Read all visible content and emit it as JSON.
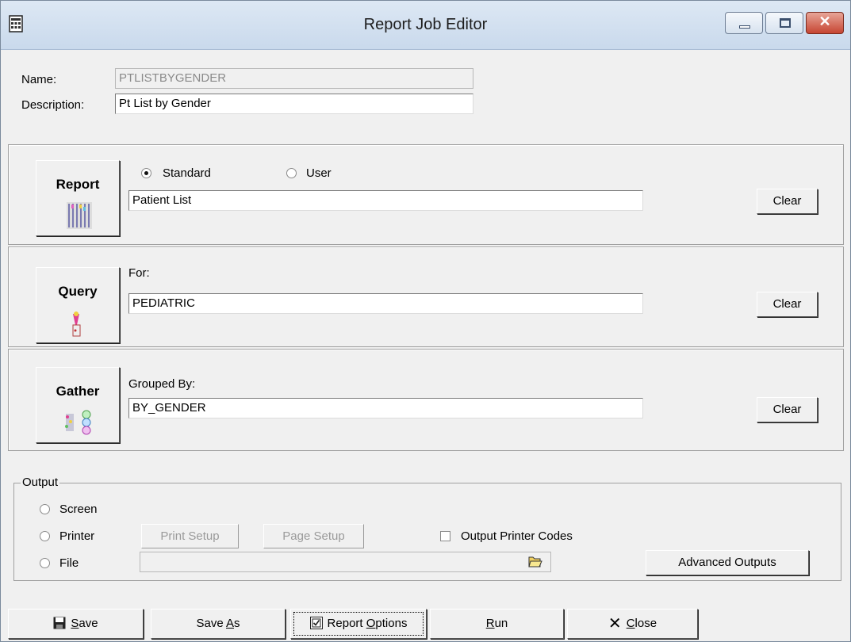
{
  "window": {
    "title": "Report Job Editor"
  },
  "header": {
    "name_label": "Name:",
    "name_value": "PTLISTBYGENDER",
    "description_label": "Description:",
    "description_value": "Pt List by Gender"
  },
  "report_panel": {
    "button_label": "Report",
    "radio_standard": "Standard",
    "radio_user": "User",
    "selected": "Standard",
    "value": "Patient List",
    "clear_label": "Clear"
  },
  "query_panel": {
    "button_label": "Query",
    "field_label": "For:",
    "value": "PEDIATRIC",
    "clear_label": "Clear"
  },
  "gather_panel": {
    "button_label": "Gather",
    "field_label": "Grouped By:",
    "value": "BY_GENDER",
    "clear_label": "Clear"
  },
  "output": {
    "legend": "Output",
    "options": [
      "Screen",
      "Printer",
      "File"
    ],
    "print_setup": "Print Setup",
    "page_setup": "Page Setup",
    "printer_codes_label": "Output Printer Codes",
    "printer_codes_checked": false,
    "file_path": "",
    "advanced_outputs": "Advanced Outputs"
  },
  "toolbar": {
    "save_prefix": "",
    "save_mnemonic": "S",
    "save_rest": "ave",
    "saveas_prefix": "Save ",
    "saveas_mnemonic": "A",
    "saveas_rest": "s",
    "report_options_prefix": "Report ",
    "report_options_mnemonic": "O",
    "report_options_rest": "ptions",
    "run_mnemonic": "R",
    "run_rest": "un",
    "close_mnemonic": "C",
    "close_rest": "lose"
  },
  "icons": {
    "app": "report-editor-icon",
    "save": "floppy-disk-icon",
    "report_options": "checklist-icon",
    "close": "x-icon",
    "folder": "open-folder-icon"
  }
}
